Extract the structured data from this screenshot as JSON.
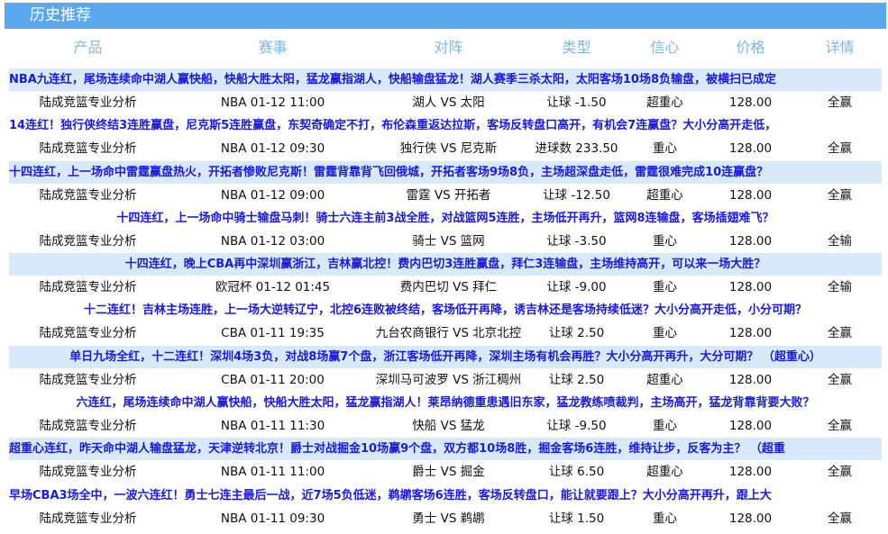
{
  "header": {
    "title": "历史推荐"
  },
  "columns": [
    "产品",
    "赛事",
    "对阵",
    "类型",
    "信心",
    "价格",
    "详情"
  ],
  "colors": {
    "header_bg": "#5aa7ee",
    "column_text": "#7fb6e6",
    "title_text": "#1a1adc",
    "row_tint": "#d8eaf9"
  },
  "entries": [
    {
      "title": "NBA九连红，尾场连续命中湖人赢快船，快船大胜太阳，猛龙赢指湖人，快船输盘猛龙！湖人赛季三杀太阳，太阳客场10场8负输盘，被横扫已成定",
      "product": "陆成竞篮专业分析",
      "match": "NBA 01-12 11:00",
      "teams": "湖人 VS 太阳",
      "type": "让球 -1.50",
      "confidence": "超重心",
      "price": "128.00",
      "result": "全赢"
    },
    {
      "title": "14连红！独行侠终结3连胜赢盘，尼克斯5连胜赢盘，东契奇确定不打，布伦森重返达拉斯，客场反转盘口高开，有机会7连赢盘？大小分高开走低，",
      "product": "陆成竞篮专业分析",
      "match": "NBA 01-12 09:30",
      "teams": "独行侠 VS 尼克斯",
      "type": "进球数 233.50",
      "confidence": "重心",
      "price": "128.00",
      "result": "全赢"
    },
    {
      "title": "十四连红，上一场命中雷霆赢盘热火，开拓者惨败尼克斯！雷霆背靠背飞回俄城，开拓者客场9场8负，主场超深盘走低，雷霆很难完成10连赢盘？",
      "product": "陆成竞篮专业分析",
      "match": "NBA 01-12 09:00",
      "teams": "雷霆 VS 开拓者",
      "type": "让球 -12.50",
      "confidence": "超重心",
      "price": "128.00",
      "result": "全赢"
    },
    {
      "title": "十四连红，上一场命中骑士输盘马刺！骑士六连主前3战全胜，对战篮网5连胜，主场低开再升，篮网8连输盘，客场插翅难飞？",
      "product": "陆成竞篮专业分析",
      "match": "NBA 01-12 03:00",
      "teams": "骑士 VS 篮网",
      "type": "让球 -3.50",
      "confidence": "重心",
      "price": "128.00",
      "result": "全输"
    },
    {
      "title": "十四连红，晚上CBA再中深圳赢浙江，吉林赢北控！费内巴切3连胜赢盘，拜仁3连输盘，主场维持高开，可以来一场大胜？",
      "product": "陆成竞篮专业分析",
      "match": "欧冠杯 01-12 01:45",
      "teams": "费内巴切 VS 拜仁",
      "type": "让球 -9.00",
      "confidence": "重心",
      "price": "128.00",
      "result": "全输"
    },
    {
      "title": "十二连红！吉林主场连胜，上一场大逆转辽宁，北控6连败被终结，客场低开再降，诱吉林还是客场持续低迷？大小分高开走低，小分可期？",
      "product": "陆成竞篮专业分析",
      "match": "CBA 01-11 19:35",
      "teams": "九台农商银行 VS 北京北控",
      "type": "让球 2.50",
      "confidence": "重心",
      "price": "128.00",
      "result": "全赢"
    },
    {
      "title": "单日九场全红，十二连红！深圳4场3负，对战8场赢7个盘，浙江客场低开再降，深圳主场有机会再胜？大小分高开再升，大分可期？ （超重心）",
      "product": "陆成竞篮专业分析",
      "match": "CBA 01-11 20:00",
      "teams": "深圳马可波罗 VS 浙江稠州",
      "type": "让球 2.50",
      "confidence": "超重心",
      "price": "128.00",
      "result": "全赢"
    },
    {
      "title": "六连红，尾场连续命中湖人赢快船，快船大胜太阳，猛龙赢指湖人！莱昂纳德重患遇旧东家，猛龙教练喷裁判，主场高开，猛龙背靠背要大败？",
      "product": "陆成竞篮专业分析",
      "match": "NBA 01-11 11:30",
      "teams": "快船 VS 猛龙",
      "type": "让球 -9.50",
      "confidence": "重心",
      "price": "128.00",
      "result": "全赢"
    },
    {
      "title": "超重心连红，昨天命中湖人输盘猛龙，天津逆转北京！爵士对战掘金10场赢9个盘，双方都10场8胜，掘金客场6连胜，维持让步，反客为主？ （超重",
      "product": "陆成竞篮专业分析",
      "match": "NBA 01-11 11:00",
      "teams": "爵士 VS 掘金",
      "type": "让球 6.50",
      "confidence": "超重心",
      "price": "128.00",
      "result": "全赢"
    },
    {
      "title": "早场CBA3场全中，一波六连红！勇士七连主最后一战，近7场5负低迷，鹈鹕客场6连胜，客场反转盘口，能让就要跟上？大小分高开再升，跟上大",
      "product": "陆成竞篮专业分析",
      "match": "NBA 01-11 09:30",
      "teams": "勇士 VS 鹈鹕",
      "type": "让球 1.50",
      "confidence": "重心",
      "price": "128.00",
      "result": "全赢"
    }
  ]
}
